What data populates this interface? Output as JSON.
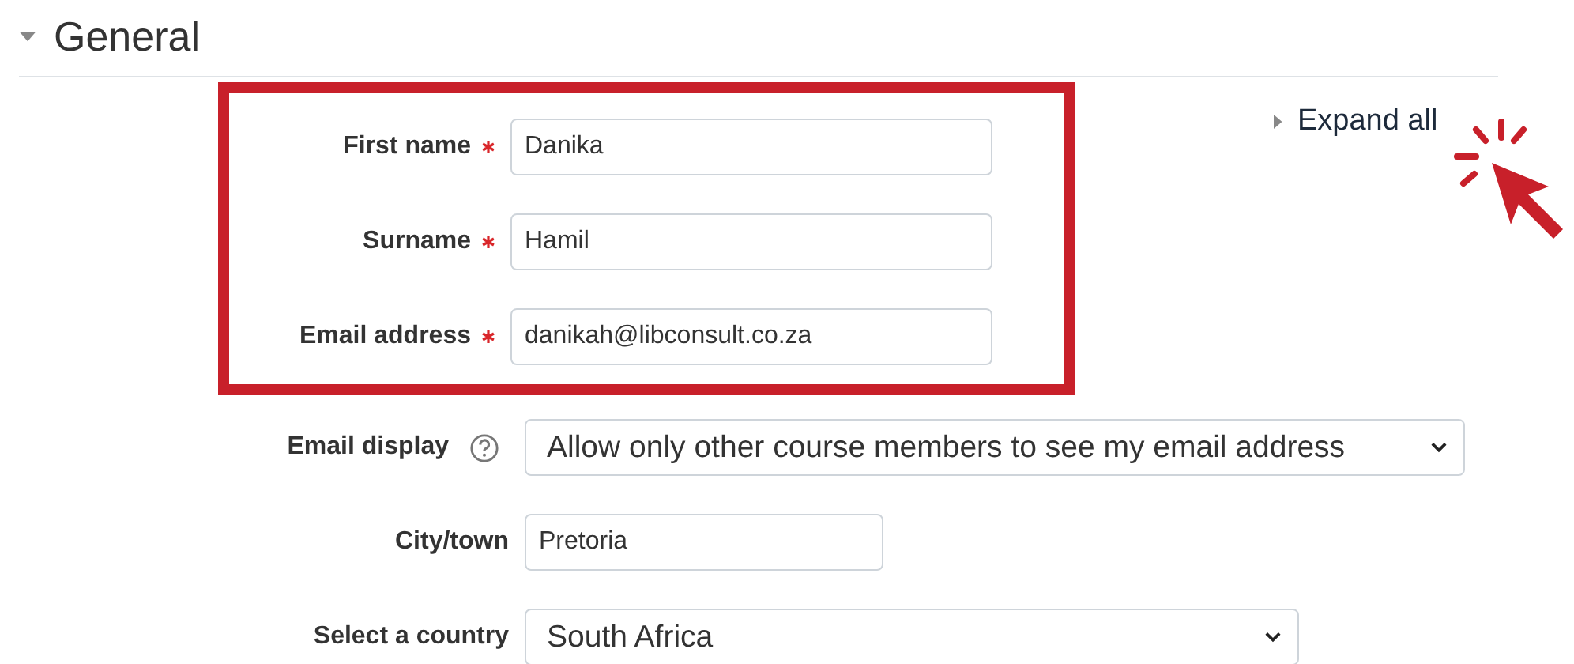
{
  "section": {
    "title": "General",
    "expanded": true
  },
  "expand_all": {
    "label": "Expand all"
  },
  "highlighted_fields": [
    {
      "kind": "text",
      "label": "First name",
      "required": true,
      "help": false,
      "value": "Danika"
    },
    {
      "kind": "text",
      "label": "Surname",
      "required": true,
      "help": false,
      "value": "Hamil"
    },
    {
      "kind": "text",
      "label": "Email address",
      "required": true,
      "help": false,
      "value": "danikah@libconsult.co.za"
    }
  ],
  "fields": [
    {
      "kind": "select",
      "label": "Email display",
      "required": false,
      "help": true,
      "value": "Allow only other course members to see my email address"
    },
    {
      "kind": "text",
      "label": "City/town",
      "required": false,
      "help": false,
      "value": "Pretoria"
    },
    {
      "kind": "select",
      "label": "Select a country",
      "required": false,
      "help": false,
      "value": "South Africa"
    }
  ]
}
